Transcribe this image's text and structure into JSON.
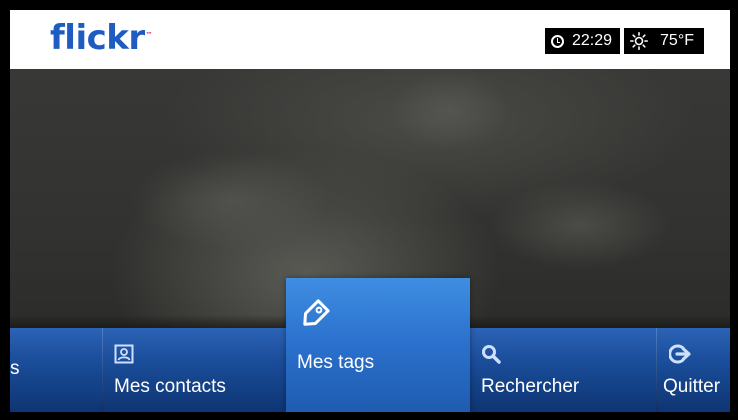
{
  "app": {
    "logo_text": "flickr",
    "logo_tm": "™"
  },
  "status": {
    "time": "22:29",
    "temperature": "75°F",
    "clock_icon": "clock-icon",
    "weather_icon": "sun-icon"
  },
  "menu": {
    "partial_left_label": "s",
    "items": [
      {
        "label": "Mes contacts",
        "icon": "contact-card-icon"
      },
      {
        "label": "Mes tags",
        "icon": "tag-icon",
        "selected": true
      },
      {
        "label": "Rechercher",
        "icon": "search-icon"
      },
      {
        "label": "Quitter",
        "icon": "exit-arrow-icon"
      }
    ]
  },
  "colors": {
    "logo_blue": "#1f5cc1",
    "menu_blue": "#1a4d9a",
    "selected_blue": "#2a70cc"
  }
}
